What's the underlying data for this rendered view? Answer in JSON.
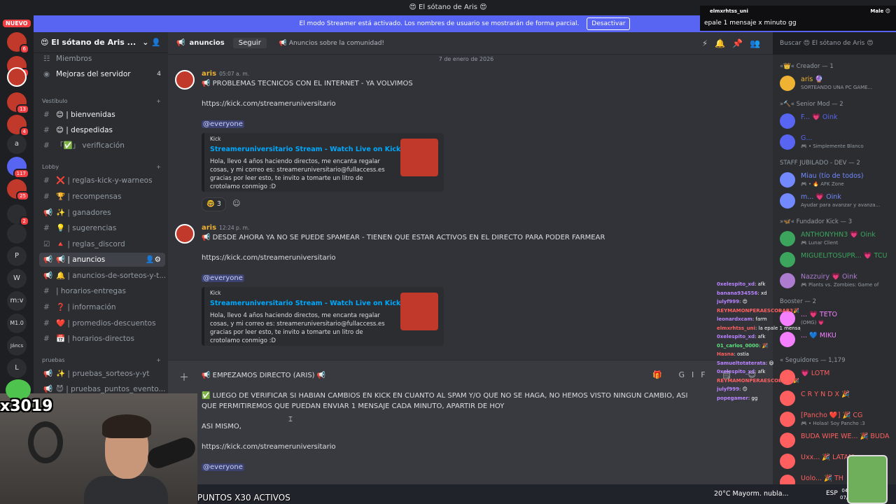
{
  "window": {
    "title": "😍 El sótano de Aris 😍"
  },
  "streamer": {
    "message": "El modo Streamer está activado. Los nombres de usuario se mostrarán de forma parcial.",
    "button": "Desactivar"
  },
  "rail": {
    "nuevo": "NUEVO",
    "labels": [
      "a",
      "P",
      "W",
      "m:v",
      "M1.0",
      "Jáncs",
      "L"
    ],
    "badges": [
      "6",
      "5",
      "13",
      "4",
      "117",
      "25",
      "2"
    ]
  },
  "sidebar": {
    "server_name": "😍 El sótano de Aris ...",
    "items": [
      {
        "icon": "☷",
        "label": "Miembros"
      },
      {
        "icon": "◉",
        "label": "Mejoras del servidor",
        "count": "4"
      },
      {
        "cat": "Vestíbulo"
      },
      {
        "icon": "#",
        "label": "😊 | bienvenidas"
      },
      {
        "icon": "#",
        "label": "😊 | despedidas"
      },
      {
        "icon": "#",
        "label": "「✅」 verificación"
      },
      {
        "cat": "Lobby"
      },
      {
        "icon": "#",
        "label": "❌ | reglas-kick-y-warneos"
      },
      {
        "icon": "#",
        "label": "🏆 | recompensas"
      },
      {
        "icon": "📢",
        "label": "✨ | ganadores"
      },
      {
        "icon": "#",
        "label": "💡 | sugerencias"
      },
      {
        "icon": "☑",
        "label": "🔺 | reglas_discord"
      },
      {
        "icon": "📢",
        "label": "📢 | anuncios"
      },
      {
        "icon": "📢",
        "label": "🔔 | anuncios-de-sorteos-y-t..."
      },
      {
        "icon": "#",
        "label": "| horarios-entregas"
      },
      {
        "icon": "#",
        "label": "❓ | información"
      },
      {
        "icon": "#",
        "label": "❤️ | promedios-descuentos"
      },
      {
        "icon": "#",
        "label": "📅 | horarios-directos"
      },
      {
        "cat": "pruebas"
      },
      {
        "icon": "📢",
        "label": "✨ | pruebas_sorteos-y-yt"
      },
      {
        "icon": "📢",
        "label": "😈 | pruebas_puntos_evento..."
      }
    ]
  },
  "header": {
    "channel": "anuncios",
    "follow": "Seguir",
    "topic": "📢 Anuncios sobre la comunidad!"
  },
  "chat": {
    "date": "7 de enero de 2026",
    "messages": [
      {
        "author": "aris",
        "time": "05:07 a. m.",
        "text": "📢 PROBLEMAS TECNICOS CON EL INTERNET - YA VOLVIMOS",
        "link": "https://kick.com/streameruniversitario",
        "mention": "@everyone",
        "embed_provider": "Kick",
        "embed_title": "Streameruniversitario Stream - Watch Live on Kick",
        "embed_desc": "Hola, llevo 4 años haciendo directos, me encanta regalar cosas, y mi correo es: streameruniversitario@fullaccess.es gracias por leer esto, te invito a tomarte un litro de crotolamo conmigo :D",
        "reaction": "🤓 3"
      },
      {
        "author": "aris",
        "time": "12:24 p. m.",
        "text": "📢 DESDE AHORA YA NO SE PUEDE SPAMEAR - TIENEN QUE ESTAR ACTIVOS EN EL DIRECTO PARA PODER FARMEAR",
        "link": "https://kick.com/streameruniversitario",
        "mention": "@everyone",
        "embed_provider": "Kick",
        "embed_title": "Streameruniversitario Stream - Watch Live on Kick",
        "embed_desc": "Hola, llevo 4 años haciendo directos, me encanta regalar cosas, y mi correo es: streameruniversitario@fullaccess.es gracias por leer esto, te invito a tomarte un litro de crotolamo conmigo :D"
      }
    ]
  },
  "composer": {
    "lines": [
      "📢 EMPEZAMOS DIRECTO (ARIS) 📢",
      "✅ LUEGO DE VERIFICAR SI HABIAN CAMBIOS EN KICK EN CUANTO AL SPAM Y/O QUE NO SE HAGA, NO HEMOS VISTO NINGUN CAMBIO, ASI",
      "QUE PERMITIREMOS QUE PUEDAN ENVIAR 1 MENSAJE CADA MINUTO, APARTIR DE HOY",
      "ASI MISMO,",
      "https://kick.com/streameruniversitario",
      "@everyone"
    ]
  },
  "members": {
    "search": "Buscar 😍 El sótano de Aris 😍",
    "groups": [
      {
        "title": "«👑« Creador — 1",
        "members": [
          {
            "name": "aris 🔮",
            "status": "SORTEANDO UNA PC GAME...",
            "color": "#f0b232"
          }
        ]
      },
      {
        "title": "»🔨« Senior Mod — 2",
        "members": [
          {
            "name": "F... 💗 Oink",
            "status": "",
            "color": "#5865f2"
          },
          {
            "name": "G...",
            "status": "🎮 • Simplemente Blanco",
            "color": "#5865f2"
          }
        ]
      },
      {
        "title": "STAFF JUBILADO - DEV — 2",
        "members": [
          {
            "name": "Miau (tío de todos)",
            "status": "🎮 • 🔥 AFK Zone",
            "color": "#7289ff"
          },
          {
            "name": "m... 💗 Oink",
            "status": "Ayudar para avanzar y avanza...",
            "color": "#7289ff"
          }
        ]
      },
      {
        "title": "»🦋« Fundador Kick — 3",
        "members": [
          {
            "name": "ANTHONYHN3 💗 Oink",
            "status": "🎮 Lunar Client",
            "color": "#3ba55d"
          },
          {
            "name": "MIGUELITOSUPR... 💗 TCU",
            "status": "",
            "color": "#3ba55d"
          },
          {
            "name": "Nazzuiry 💗 Oink",
            "status": "🎮 Plants vs. Zombies: Game of",
            "color": "#ad7cd1"
          }
        ]
      },
      {
        "title": "Booster — 2",
        "members": [
          {
            "name": "... 💗 TETO",
            "status": "(OMG) 💗",
            "color": "#f47fff"
          },
          {
            "name": "... 💙 MIKU",
            "status": "",
            "color": "#f47fff"
          }
        ]
      },
      {
        "title": "« Seguidores — 1,179",
        "members": [
          {
            "name": "💗 LOTM",
            "status": "",
            "color": "#ff5f5f"
          },
          {
            "name": "C R Y N D X 🎉",
            "status": "",
            "color": "#ff5f5f"
          },
          {
            "name": "[Pancho ❤️] 🎉 CG",
            "status": "🎮 • Holaa! Soy Pancho :3",
            "color": "#ff5f5f"
          },
          {
            "name": "BUDA WIPE WE... 🎉 BUDA",
            "status": "",
            "color": "#ff5f5f"
          },
          {
            "name": "Uxx... 🎉 LATAM",
            "status": "",
            "color": "#ff5f5f"
          },
          {
            "name": "Uolo... 🎉 TH",
            "status": "",
            "color": "#ff5f5f"
          }
        ]
      }
    ]
  },
  "overlay": {
    "user": "elmxrhtss_uni",
    "male": "Male 😊",
    "message": "epale 1 mensaje x minuto gg",
    "chat": [
      {
        "u": "0xelespito_xd",
        "t": ": afk",
        "c": ""
      },
      {
        "u": "banana934556",
        "t": ": xd",
        "c": ""
      },
      {
        "u": "julyf999",
        "t": ": 😍",
        "c": ""
      },
      {
        "u": "REYMAMONPERAESCOBAR3",
        "t": "🎉",
        "c": "r"
      },
      {
        "u": "leonardxcam",
        "t": ": farm",
        "c": ""
      },
      {
        "u": "elmxrhtss_uni",
        "t": ": la epale 1 mensaje x minuto gg",
        "c": "r"
      },
      {
        "u": "0xelespito_xd",
        "t": ": afk",
        "c": ""
      },
      {
        "u": "01_carlos_0000",
        "t": ": 🎉",
        "c": "g"
      },
      {
        "u": "Hasna",
        "t": ": ostia",
        "c": "r"
      },
      {
        "u": "Samueltotaterata",
        "t": ": 😃",
        "c": ""
      },
      {
        "u": "0xelespito_xd",
        "t": ": afk",
        "c": ""
      },
      {
        "u": "REYMAMONPERAESCOBAR3",
        "t": "🎉",
        "c": "r"
      },
      {
        "u": "julyf999",
        "t": ": 😊",
        "c": ""
      },
      {
        "u": "popegamer",
        "t": ": gg",
        "c": ""
      }
    ]
  },
  "webcam": {
    "label": "x3019"
  },
  "taskbar": {
    "overlay_text": "PUNTOS X30 ACTIVOS",
    "weather": "20°C  Mayorm. nubla...",
    "lang": "ESP",
    "time": "04:11",
    "date": "07/01/"
  }
}
